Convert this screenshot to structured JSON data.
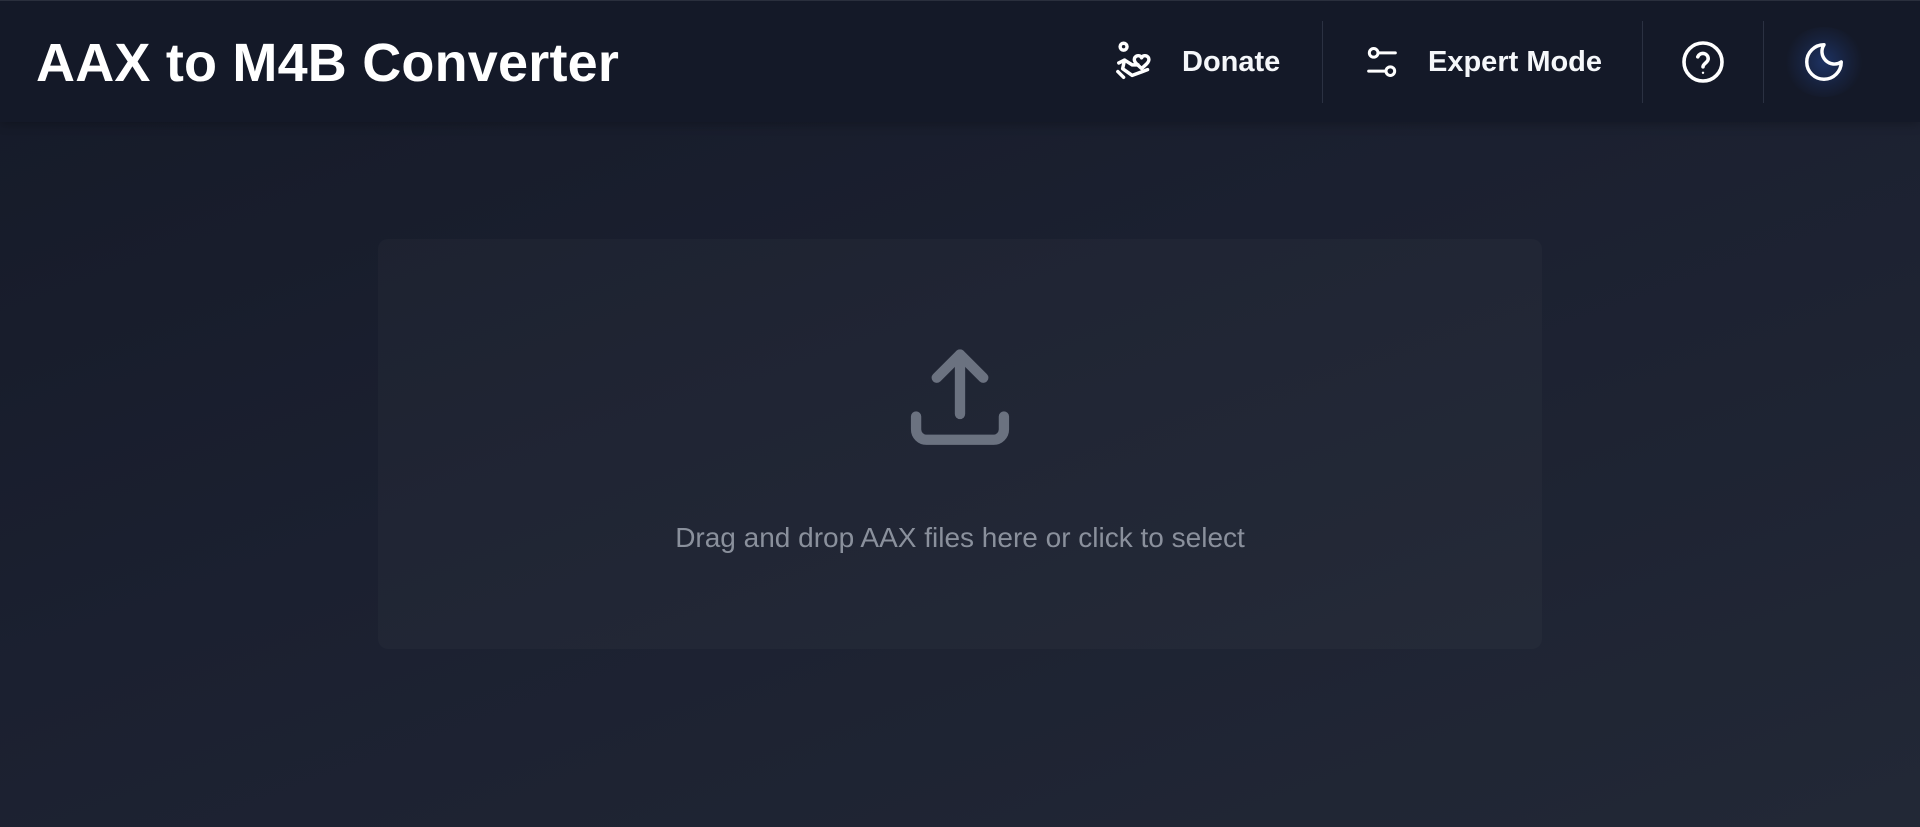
{
  "header": {
    "title": "AAX to M4B Converter",
    "donate_label": "Donate",
    "expert_mode_label": "Expert Mode",
    "donate_icon": "hand-heart-icon",
    "expert_mode_icon": "sliders-icon",
    "help_icon": "help-circle-icon",
    "theme_icon": "moon-icon"
  },
  "dropzone": {
    "text": "Drag and drop AAX files here or click to select",
    "icon": "upload-icon"
  },
  "colors": {
    "background": "#1b2030",
    "header_background": "#141928",
    "dropzone_text": "#8a909c",
    "upload_icon": "#6b7280"
  }
}
